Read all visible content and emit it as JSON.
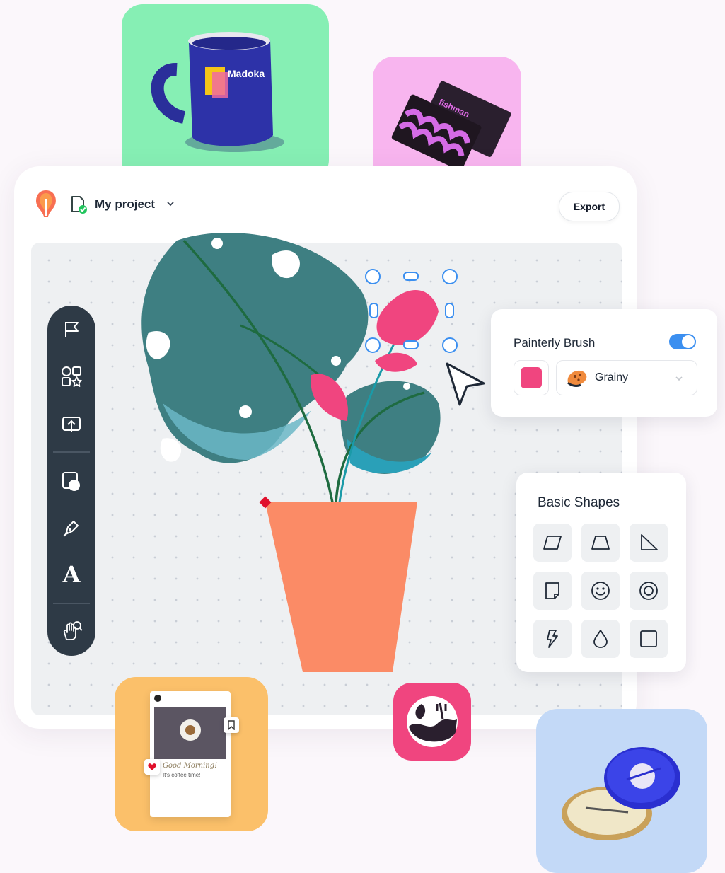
{
  "project": {
    "name": "My project",
    "export_label": "Export"
  },
  "brush_panel": {
    "title": "Painterly Brush",
    "toggle_on": true,
    "swatch_color": "#f0457f",
    "texture": "Grainy"
  },
  "shapes_panel": {
    "title": "Basic Shapes",
    "shapes": [
      "parallelogram-icon",
      "trapezoid-icon",
      "right-triangle-icon",
      "folded-page-icon",
      "smiley-icon",
      "ring-icon",
      "lightning-icon",
      "droplet-icon",
      "square-icon"
    ]
  },
  "toolbar": {
    "tools": [
      "flag-icon",
      "elements-icon",
      "upload-icon",
      "shape-layer-icon",
      "pen-icon",
      "text-icon",
      "hand-zoom-icon"
    ],
    "text_tool_glyph": "A"
  },
  "mockups": {
    "mug_brand": "Madoka",
    "card_brand": "fishman",
    "post_caption": "Good Morning!",
    "post_subcaption": "It's coffee time!"
  },
  "colors": {
    "accent_blue": "#3b8ff0",
    "pink": "#f0457f",
    "pot": "#fb8b66",
    "leaf": "#3e7f82",
    "toolbar": "#2e3a46"
  }
}
